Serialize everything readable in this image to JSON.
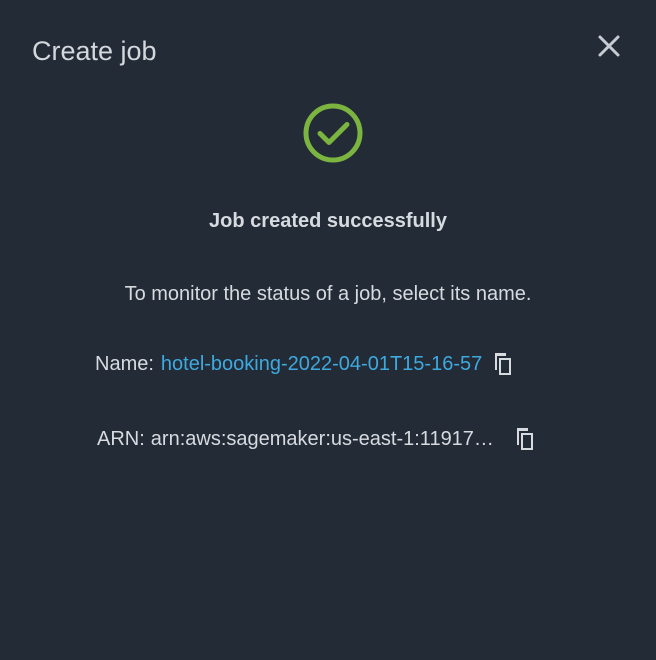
{
  "modal": {
    "title": "Create job",
    "close_icon": "close-icon"
  },
  "status": {
    "icon": "check-circle-icon",
    "icon_color": "#7bb540",
    "title": "Job created successfully",
    "instruction": "To monitor the status of a job, select its name."
  },
  "job": {
    "name_label": "Name:",
    "name_value": "hotel-booking-2022-04-01T15-16-57",
    "name_link_color": "#3ea9de",
    "arn_label": "ARN:",
    "arn_value": "arn:aws:sagemaker:us-east-1:11917…",
    "copy_icon": "copy-icon"
  },
  "colors": {
    "background": "#232b37",
    "text": "#d7dbe0"
  }
}
